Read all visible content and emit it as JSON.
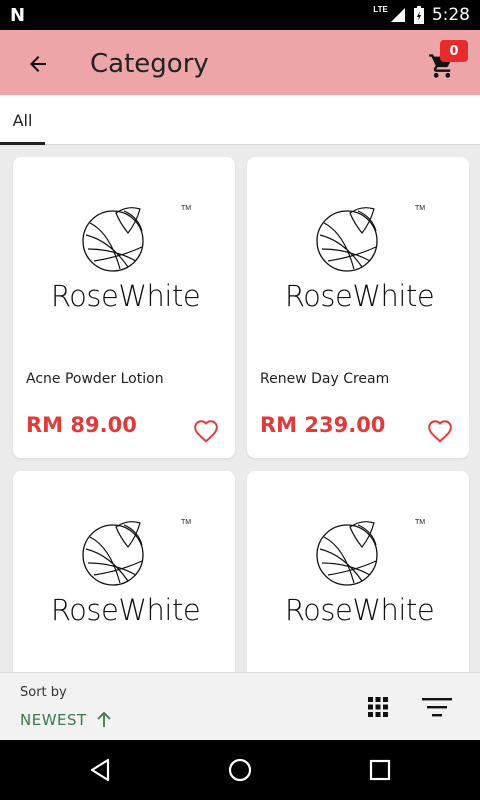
{
  "status_bar": {
    "time": "5:28",
    "network": "LTE"
  },
  "app_bar": {
    "title": "Category",
    "cart_count": "0"
  },
  "tabs": [
    {
      "label": "All"
    }
  ],
  "products": [
    {
      "brand": "RoseWhite",
      "tm": "TM",
      "name": "Acne Powder Lotion",
      "price": "RM 89.00"
    },
    {
      "brand": "RoseWhite",
      "tm": "TM",
      "name": "Renew Day Cream",
      "price": "RM 239.00"
    },
    {
      "brand": "RoseWhite",
      "tm": "TM",
      "name": "",
      "price": ""
    },
    {
      "brand": "RoseWhite",
      "tm": "TM",
      "name": "",
      "price": ""
    }
  ],
  "sort": {
    "label": "Sort by",
    "value": "NEWEST",
    "direction_icon": "arrow-up-icon"
  },
  "colors": {
    "app_bar": "#eea5a8",
    "price": "#e03b3b",
    "sort_value": "#3c7a4a",
    "badge": "#e52b2b"
  }
}
